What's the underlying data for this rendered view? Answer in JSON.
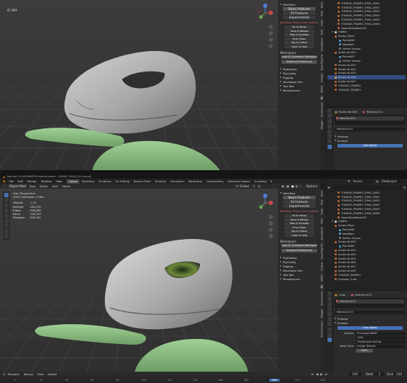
{
  "top_shot": {
    "viewport_label": "41.900",
    "n_panel": {
      "workflow_header": "Workflow",
      "workflow_buttons": [
        "Basic Features",
        "All Features",
        "Experimental"
      ],
      "workflow_warning": "Workflow Phase (Live Installed)",
      "workflow_small": [
        "Go to Setup",
        "Trace & Retopo",
        "Pose & Animate",
        "Final Clean",
        "Tag & Collect",
        "Learn & Help"
      ],
      "workspace_label": "Workspace",
      "workspace_btn": "Load 3L Animation Workspace",
      "prefs_btn": "Assistant Preferences",
      "collapsed": [
        "PigDisplay",
        "PigConfig",
        "Rigging",
        "Developer Kits",
        "Tool Box",
        "Maintenance"
      ]
    },
    "outliner": [
      "TONGUE_FRAME0_PIVAL_B001",
      "TONGUE_FRAME1_PIVAL_B002",
      "TONGUE_FRAME1_PIVAL_B003",
      "TONGUE_FRAME1_PIVAL_B004",
      "TONGUE_FRAME1_PIVAL_B005",
      "TONGUE_FRAME1_PIVAL_B006",
      "UpperBodyMesh002",
      "Hidden",
      "Snake_Plane",
      "Plane008",
      "Modifiers",
      "Vertex Groups",
      "Snake Iat.003",
      "Plane009",
      "Vertex Groups",
      "Snake Iat.003",
      "Snake Iat.004",
      "Snake Iat.005",
      "Snake Iat.006",
      "Snake Iat.007",
      "TONGUE_FRAME2",
      "TONGUE_FRAME3"
    ],
    "props": {
      "object_name": "Snake Iat.006",
      "material_name": "Material.011",
      "material_slot": "Material.011",
      "material_field": "Material.011",
      "preview_label": "Preview",
      "surface_label": "Surface",
      "use_nodes": "Use Nodes"
    }
  },
  "bottom_shot": {
    "title_bar": "Blender* [D:\\BLENDER\\Projects\\Snake\\...\\SNAKE_HEAD_002.blend]",
    "menus": [
      "File",
      "Edit",
      "Render",
      "Window",
      "Help"
    ],
    "workspaces": [
      "Layout",
      "Modeling",
      "Sculpting",
      "UV Editing",
      "Texture Paint",
      "Shading",
      "Animation",
      "Rendering",
      "Compositing",
      "Geometry Nodes",
      "Scripting"
    ],
    "active_workspace": "Layout",
    "scene_label": "Scene",
    "view_layer_label": "ViewLayer",
    "mode_label": "Object Mode",
    "header_menus": [
      "View",
      "Select",
      "Add",
      "Object"
    ],
    "global_label": "Global",
    "options_label": "Options",
    "stats": {
      "view": "User Perspective",
      "collection": "(200) Collection | Cube",
      "objects_label": "Objects",
      "objects": "1 / 8",
      "vertices_label": "Vertices",
      "vertices": "128,270",
      "edges_label": "Edges",
      "edges": "256,858",
      "faces_label": "Faces",
      "faces": "128,707",
      "triangles_label": "Triangles",
      "triangles": "256,522"
    },
    "n_panel": {
      "workflow_header": "Workflow",
      "workflow_buttons": [
        "Basic Features",
        "All Features",
        "Experimental"
      ],
      "workflow_warning": "Workflow Phase (Live Installed)",
      "workflow_small": [
        "Go to Setup",
        "Trace & Retopo",
        "Pose & Animate",
        "Final Clean",
        "Tag & Collect",
        "Learn & Help"
      ],
      "workspace_label": "Workspace",
      "workspace_btn": "Load 3L Animation Workspace",
      "prefs_btn": "Assistant Preferences",
      "collapsed": [
        "PigDisplay",
        "PigConfig",
        "Rigging",
        "Developer Kits",
        "Tool Box",
        "Maintenance"
      ]
    },
    "outliner": [
      "TONGUE_FRAME0_PIVAL_B001",
      "TONGUE_FRAME1_PIVAL_B002",
      "TONGUE_FRAME1_PIVAL_B003",
      "TONGUE_FRAME1_PIVAL_B004",
      "TONGUE_FRAME1_PIVAL_B005",
      "TONGUE_FRAME1_PIVAL_B006",
      "UpperBodyMesh002",
      "Hidden",
      "Snake_Plane",
      "Plane008",
      "Modifiers",
      "Vertex Groups",
      "Snake Iat.003",
      "Plane009",
      "Snake Iat.003",
      "Snake Iat.004",
      "Snake Iat.005",
      "Snake Iat.006",
      "Snake Iat.007",
      "Snake Iat.008",
      "TONGUE_FRAME2",
      "Collision_Cube"
    ],
    "props": {
      "object_name": "Cube",
      "material_name": "Material.013",
      "material_slot": "Material.013",
      "material_field": "Material.013",
      "preview_label": "Preview",
      "surface_label": "Surface",
      "use_nodes": "Use Nodes",
      "surface_field_label": "Surface",
      "surface_value": "Principled BSDF",
      "ggx": "GGX",
      "random_walk": "Christensen-Burley",
      "base_color_label": "Base Color",
      "base_color_value": "Image Texture",
      "open_btn": "Open"
    },
    "timeline": {
      "menus": [
        "Playback",
        "Keying",
        "View",
        "Marker"
      ],
      "start_label": "Start",
      "start": "1",
      "end_label": "End",
      "end": "250",
      "current": "200",
      "ticks": [
        "0",
        "20",
        "40",
        "60",
        "80",
        "100",
        "120",
        "140",
        "160",
        "180",
        "200",
        "220",
        "240"
      ]
    }
  },
  "vertical_tabs_top": [
    "Item",
    "Tool",
    "View",
    "Edit",
    "Animation",
    "Auto-Rig Pro",
    "Create",
    "MAYA",
    "3L",
    "Screencast",
    "Wiggle"
  ],
  "vertical_tabs_bottom": [
    "Item",
    "Tool",
    "View",
    "Edit",
    "Animation",
    "Auto-Rig Pro",
    "Create",
    "MAYA",
    "3L",
    "Screencast",
    "Wiggle",
    "Pose Library"
  ],
  "colors": {
    "accent": "#4772b3",
    "selection": "#334d80",
    "mesh_gray": "#a9a9a9",
    "mesh_green": "#8fbf86"
  },
  "icons": {
    "eye": "eye-icon",
    "camera": "camera-icon",
    "filter": "filter-icon"
  }
}
